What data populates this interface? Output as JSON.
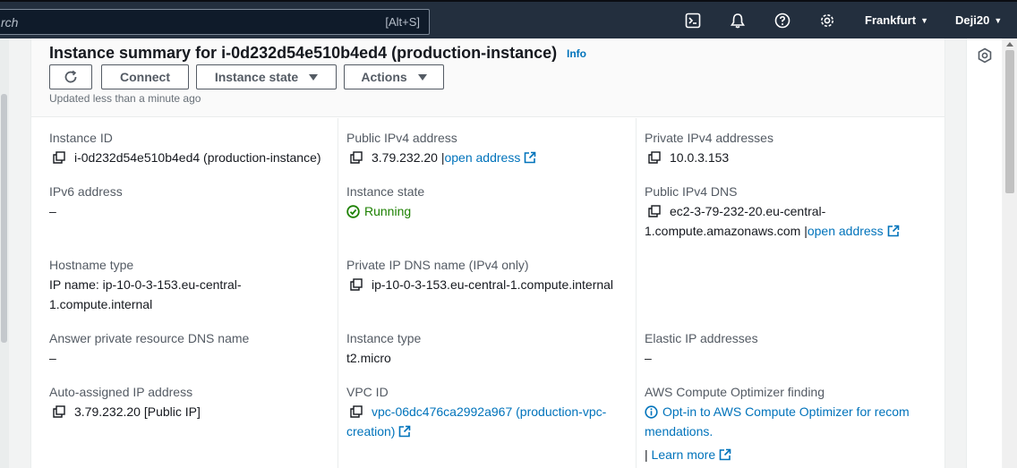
{
  "topnav": {
    "search_placeholder": "rch",
    "search_shortcut": "[Alt+S]",
    "region": "Frankfurt",
    "user": "Deji20",
    "icons": [
      "cloudshell-icon",
      "bell-icon",
      "help-icon",
      "gear-icon"
    ]
  },
  "summary": {
    "title": "Instance summary for i-0d232d54e510b4ed4 (production-instance)",
    "info": "Info",
    "updated": "Updated less than a minute ago",
    "buttons": {
      "connect": "Connect",
      "instance_state": "Instance state",
      "actions": "Actions"
    }
  },
  "fields": {
    "instance_id": {
      "label": "Instance ID",
      "value": "i-0d232d54e510b4ed4 (production-instance)"
    },
    "public_ipv4": {
      "label": "Public IPv4 address",
      "value": "3.79.232.20 |",
      "link": "open address"
    },
    "private_ipv4": {
      "label": "Private IPv4 addresses",
      "value": "10.0.3.153"
    },
    "ipv6": {
      "label": "IPv6 address",
      "value": "–"
    },
    "instance_state": {
      "label": "Instance state",
      "value": "Running"
    },
    "public_dns": {
      "label": "Public IPv4 DNS",
      "line1": "ec2-3-79-232-20.eu-central-",
      "line2": "1.compute.amazonaws.com |",
      "link": "open address"
    },
    "hostname_type": {
      "label": "Hostname type",
      "line1": "IP name: ip-10-0-3-153.eu-central-",
      "line2": "1.compute.internal"
    },
    "private_dns": {
      "label": "Private IP DNS name (IPv4 only)",
      "value": "ip-10-0-3-153.eu-central-1.compute.internal"
    },
    "answer_dns": {
      "label": "Answer private resource DNS name",
      "value": "–"
    },
    "instance_type": {
      "label": "Instance type",
      "value": "t2.micro"
    },
    "elastic_ip": {
      "label": "Elastic IP addresses",
      "value": "–"
    },
    "auto_ip": {
      "label": "Auto-assigned IP address",
      "value": "3.79.232.20 [Public IP]"
    },
    "vpc_id": {
      "label": "VPC ID",
      "line1": "vpc-06dc476ca2992a967 (production-vpc-",
      "line2": "creation)"
    },
    "optimizer": {
      "label": "AWS Compute Optimizer finding",
      "line1": "Opt-in to AWS Compute Optimizer for recom",
      "line2": "mendations.",
      "sep": "|",
      "learn_more": "Learn more"
    }
  },
  "colors": {
    "nav_bg": "#232f3e",
    "link": "#0073bb",
    "success": "#1d8102",
    "text": "#16191f",
    "label": "#545b64"
  }
}
